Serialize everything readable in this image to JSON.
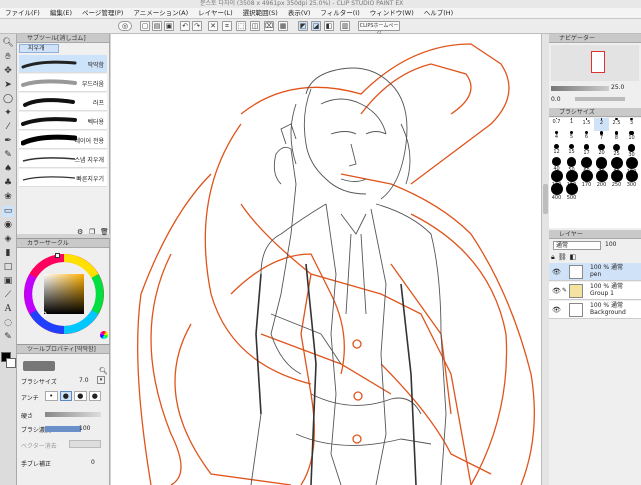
{
  "window": {
    "title": "문스토 다자이 (3508 x 4961px 350dpi 25.0%) - CLIP STUDIO PAINT EX"
  },
  "menu": [
    "ファイル(F)",
    "編集(E)",
    "ページ管理(P)",
    "アニメーション(A)",
    "レイヤー(L)",
    "選択範囲(S)",
    "表示(V)",
    "フィルター(I)",
    "ウィンドウ(W)",
    "ヘルプ(H)"
  ],
  "command_bar": {
    "clip_button": "CLIPSホームページ"
  },
  "subtool": {
    "header": "サブツール[消しゴム]",
    "group": "지우개",
    "brushes": [
      "딱딱함",
      "부드러움",
      "러프",
      "벡터용",
      "레이어 전용",
      "스냅 지우개",
      "빠른지우기"
    ]
  },
  "color_panel": {
    "header": "カラーサークル"
  },
  "tool_property": {
    "header": "ツールプロパティ[딱딱함]",
    "brush_size_label": "ブラシサイズ",
    "brush_size": "7.0",
    "antialias_label": "アンチ",
    "hardness_label": "硬さ",
    "density_label": "ブラシ濃度",
    "density": "100",
    "vector_label": "ベクター消去",
    "stabilization_label": "手ブレ補正",
    "stabilization": "0"
  },
  "navigator": {
    "header": "ナビゲーター",
    "zoom": "25.0",
    "rotation": "0.0"
  },
  "brush_size_palette": {
    "header": "ブラシサイズ",
    "sizes": [
      "0.7",
      "1",
      "1.5",
      "2",
      "2.5",
      "3",
      "4",
      "5",
      "6",
      "7",
      "8",
      "10",
      "12",
      "15",
      "17",
      "20",
      "25",
      "30",
      "40",
      "50",
      "60",
      "70",
      "80",
      "100",
      "120",
      "150",
      "170",
      "200",
      "250",
      "300",
      "400",
      "500"
    ]
  },
  "layers": {
    "header": "レイヤー",
    "blend_mode": "通常",
    "opacity": "100",
    "items": [
      {
        "info": "100 % 通常",
        "name": "pen"
      },
      {
        "info": "100 % 通常",
        "name": "Group 1"
      },
      {
        "info": "100 % 通常",
        "name": "Background"
      }
    ]
  }
}
